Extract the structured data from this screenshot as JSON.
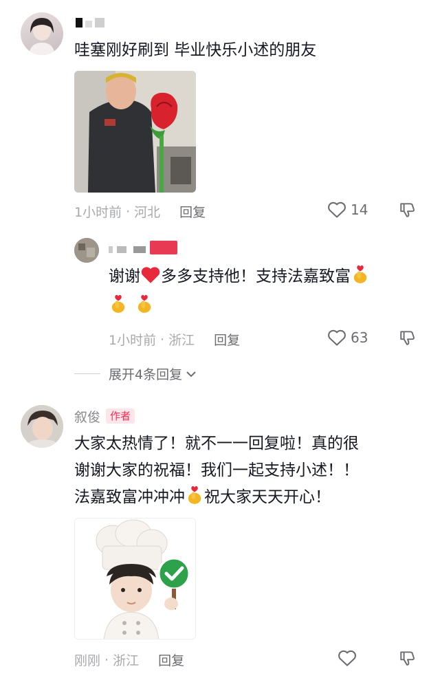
{
  "comments": [
    {
      "username": "",
      "text": "哇塞刚好刷到 毕业快乐小述的朋友",
      "time": "1小时前",
      "location": "河北",
      "reply_label": "回复",
      "likes": "14",
      "image_icon": "rose-meme-photo"
    },
    {
      "username": "",
      "text_a": "谢谢",
      "text_b": "多多支持他！支持法嘉致富",
      "time": "1小时前",
      "location": "浙江",
      "reply_label": "回复",
      "likes": "63"
    },
    {
      "username": "叙俊",
      "author_badge": "作者",
      "line1": "大家太热情了！就不一一回复啦！真的很",
      "line2": "谢谢大家的祝福！我们一起支持小述！！",
      "line3a": "法嘉致富冲冲冲",
      "line3b": "祝大家天天开心！",
      "time": "刚刚",
      "location": "浙江",
      "reply_label": "回复",
      "image_icon": "chef-cartoon-sticker"
    }
  ],
  "expand_replies": "展开4条回复",
  "colors": {
    "accent": "#fe2c55",
    "text": "#161823",
    "meta": "#a8a9ad"
  }
}
